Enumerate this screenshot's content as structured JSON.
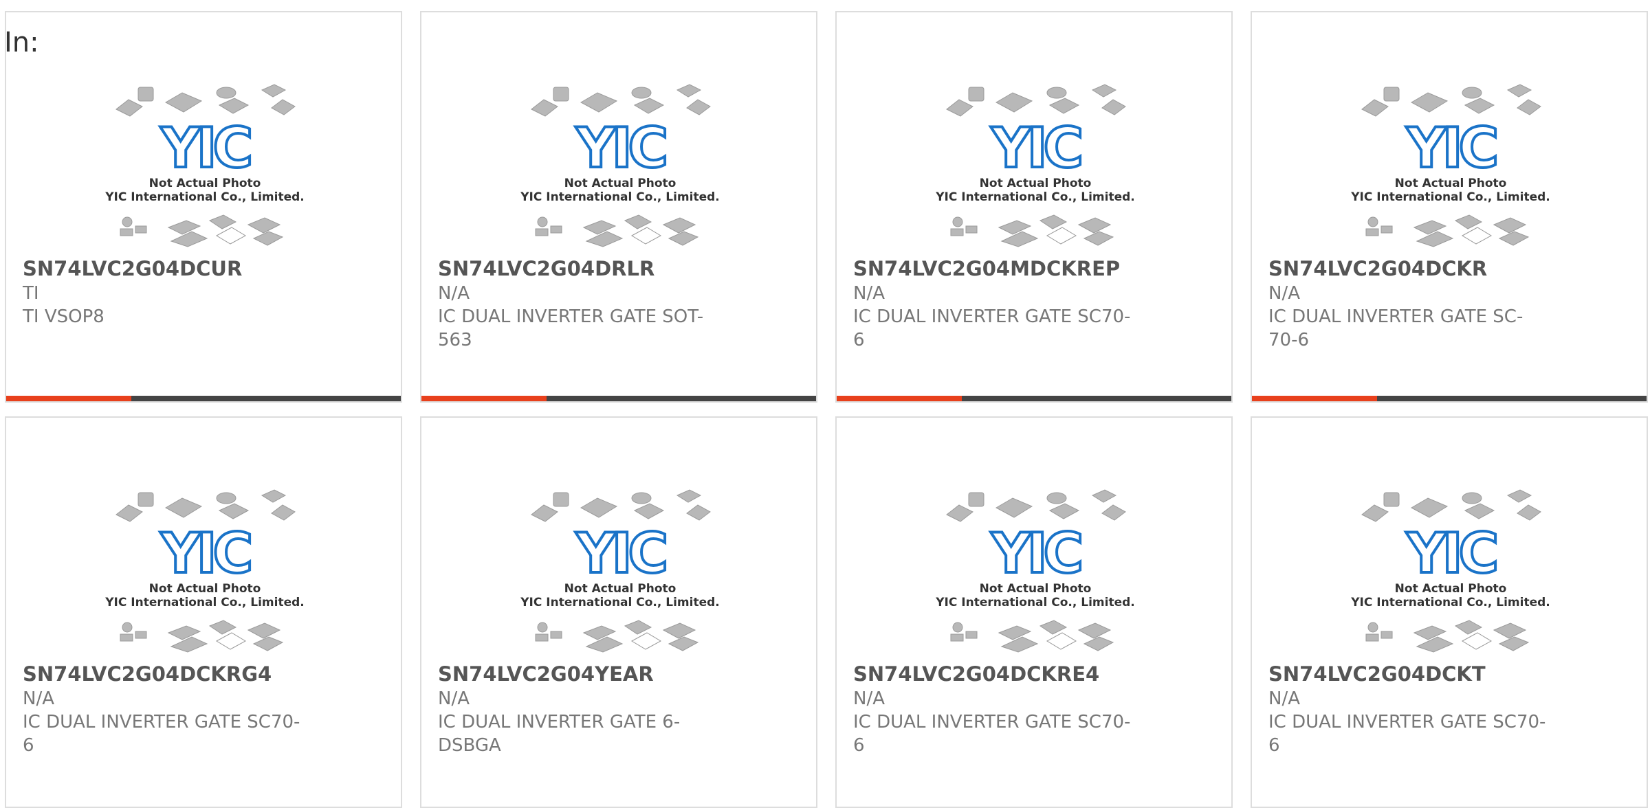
{
  "page": {
    "in_label": "In:"
  },
  "placeholder": {
    "line1": "Not Actual Photo",
    "line2": "YIC International Co., Limited.",
    "logo_text": "YIC",
    "logo_color": "#1a73c8"
  },
  "colors": {
    "accent": "#e8401c",
    "bar": "#444444",
    "border": "#dddddd"
  },
  "cards": [
    {
      "part": "SN74LVC2G04DCUR",
      "mfr": "TI",
      "desc": "TI VSOP8",
      "has_bar": true
    },
    {
      "part": "SN74LVC2G04DRLR",
      "mfr": "N/A",
      "desc": "IC DUAL INVERTER GATE SOT-563",
      "has_bar": true
    },
    {
      "part": "SN74LVC2G04MDCKREP",
      "mfr": "N/A",
      "desc": "IC DUAL INVERTER GATE SC70-6",
      "has_bar": true
    },
    {
      "part": "SN74LVC2G04DCKR",
      "mfr": "N/A",
      "desc": "IC DUAL INVERTER GATE SC-70-6",
      "has_bar": true
    },
    {
      "part": "SN74LVC2G04DCKRG4",
      "mfr": "N/A",
      "desc": "IC DUAL INVERTER GATE SC70-6",
      "has_bar": false
    },
    {
      "part": "SN74LVC2G04YEAR",
      "mfr": "N/A",
      "desc": "IC DUAL INVERTER GATE 6-DSBGA",
      "has_bar": false
    },
    {
      "part": "SN74LVC2G04DCKRE4",
      "mfr": "N/A",
      "desc": "IC DUAL INVERTER GATE SC70-6",
      "has_bar": false
    },
    {
      "part": "SN74LVC2G04DCKT",
      "mfr": "N/A",
      "desc": "IC DUAL INVERTER GATE SC70-6",
      "has_bar": false
    }
  ]
}
